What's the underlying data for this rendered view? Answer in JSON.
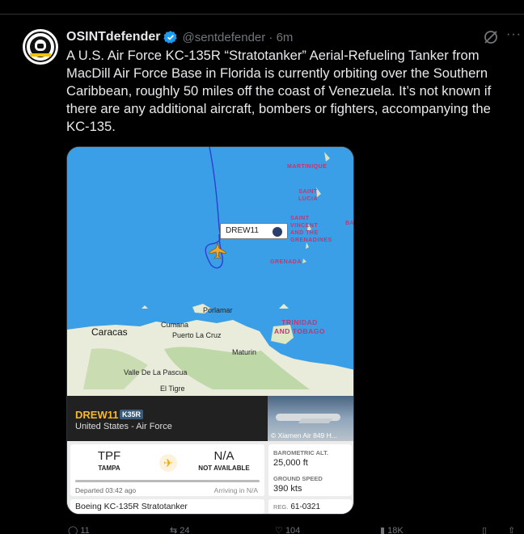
{
  "top_bar": {
    "actions": [
      "",
      "",
      "",
      "",
      "",
      ""
    ]
  },
  "tweet": {
    "author_name": "OSINTdefender",
    "handle_time": "@sentdefender · 6m",
    "more": "···",
    "text": "A U.S. Air Force KC-135R “Stratotanker” Aerial-Refueling Tanker from MacDill Air Force Base in Florida is currently orbiting over the Southern Caribbean, roughly 50 miles off the coast of Venezuela. It’s not known if there are any additional aircraft, bombers or fighters, accompanying the KC-135.",
    "actions": [
      {
        "name": "reply",
        "glyph": "◯",
        "count": "11"
      },
      {
        "name": "retweet",
        "glyph": "⇆",
        "count": "24"
      },
      {
        "name": "like",
        "glyph": "♡",
        "count": "104"
      },
      {
        "name": "views",
        "glyph": "▮",
        "count": "18K"
      },
      {
        "name": "bookmark",
        "glyph": "▯",
        "count": ""
      },
      {
        "name": "share",
        "glyph": "⇧",
        "count": ""
      }
    ]
  },
  "map": {
    "labels": {
      "martinique": "MARTINIQUE",
      "saint_lucia": "SAINT\nLUCIA",
      "svg": "SAINT\nVINCENT\nAND THE\nGRENADINES",
      "ba": "BA",
      "grenada": "GRENADA",
      "trinidad": "TRINIDAD\nAND TOBAGO",
      "porlamar": "Porlamar",
      "caracas": "Caracas",
      "cumana": "Cumana",
      "puerto_la_cruz": "Puerto La Cruz",
      "maturin": "Maturin",
      "valle": "Valle De La Pascua",
      "el_tigre": "El Tigre"
    },
    "flight_tag": "DREW11"
  },
  "flight": {
    "callsign": "DREW11",
    "type_code": "K35R",
    "operator": "United States - Air Force",
    "photo_credit": "© Xiamen Air 849 H...",
    "from_code": "TPF",
    "from_name": "TAMPA",
    "to_code": "N/A",
    "to_name": "NOT AVAILABLE",
    "departed": "Departed 03:42 ago",
    "arriving": "Arriving in N/A",
    "aircraft": "Boeing KC-135R Stratotanker",
    "baro_label": "BAROMETRIC ALT.",
    "baro_value": "25,000 ft",
    "speed_label": "GROUND SPEED",
    "speed_value": "390 kts",
    "reg_label": "REG.",
    "reg_value": "61-0321"
  }
}
